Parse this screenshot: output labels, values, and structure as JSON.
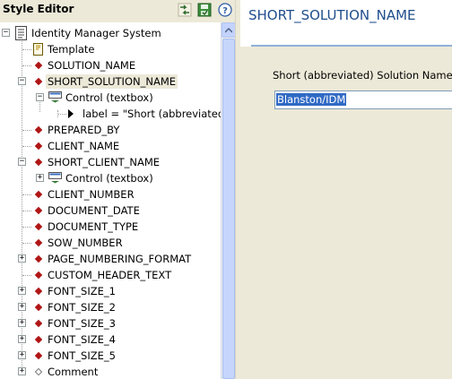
{
  "editor": {
    "panel_title": "Style Editor",
    "toolbar_icons": [
      "move-icon",
      "save-green-icon",
      "help-icon"
    ]
  },
  "tree": {
    "root": "Identity Manager System",
    "nodes": [
      {
        "label": "Template",
        "icon": "template-icon"
      },
      {
        "label": "SOLUTION_NAME",
        "icon": "diamond-icon"
      },
      {
        "label": "SHORT_SOLUTION_NAME",
        "icon": "diamond-icon",
        "selected": true
      },
      {
        "label": "Control (textbox)",
        "icon": "control-icon"
      },
      {
        "label": "label = \"Short (abbreviated",
        "icon": "triangle-icon"
      },
      {
        "label": "PREPARED_BY",
        "icon": "diamond-icon"
      },
      {
        "label": "CLIENT_NAME",
        "icon": "diamond-icon"
      },
      {
        "label": "SHORT_CLIENT_NAME",
        "icon": "diamond-icon"
      },
      {
        "label": "Control (textbox)",
        "icon": "control-icon"
      },
      {
        "label": "CLIENT_NUMBER",
        "icon": "diamond-icon"
      },
      {
        "label": "DOCUMENT_DATE",
        "icon": "diamond-icon"
      },
      {
        "label": "DOCUMENT_TYPE",
        "icon": "diamond-icon"
      },
      {
        "label": "SOW_NUMBER",
        "icon": "diamond-icon"
      },
      {
        "label": "PAGE_NUMBERING_FORMAT",
        "icon": "diamond-icon"
      },
      {
        "label": "CUSTOM_HEADER_TEXT",
        "icon": "diamond-icon"
      },
      {
        "label": "FONT_SIZE_1",
        "icon": "diamond-icon"
      },
      {
        "label": "FONT_SIZE_2",
        "icon": "diamond-icon"
      },
      {
        "label": "FONT_SIZE_3",
        "icon": "diamond-icon"
      },
      {
        "label": "FONT_SIZE_4",
        "icon": "diamond-icon"
      },
      {
        "label": "FONT_SIZE_5",
        "icon": "diamond-icon"
      },
      {
        "label": "Comment",
        "icon": "hollow-diamond-icon"
      }
    ]
  },
  "detail": {
    "title": "SHORT_SOLUTION_NAME",
    "field_label": "Short (abbreviated) Solution Name",
    "field_value": "Blanston/IDM"
  },
  "colors": {
    "title_blue": "#1f4e8c",
    "node_red": "#b01515",
    "selection_blue": "#316ac5"
  }
}
